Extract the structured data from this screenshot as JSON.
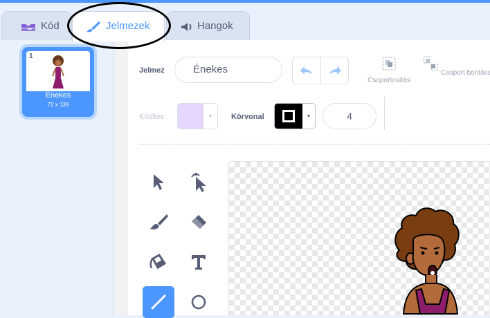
{
  "tabs": {
    "code_label": "Kód",
    "costumes_label": "Jelmezek",
    "sounds_label": "Hangok"
  },
  "costume_list": [
    {
      "number": "1",
      "name": "Énekes",
      "size": "72 x 139"
    }
  ],
  "toolbar": {
    "costume_label": "Jelmez",
    "costume_name": "Énekes",
    "group_label": "Csoportosítás",
    "ungroup_label": "Csoport bontása",
    "fill_label": "Kitöltés",
    "outline_label": "Körvonal",
    "outline_width": "4"
  },
  "colors": {
    "accent": "#4c97ff",
    "fill_swatch": "#e5d7ff",
    "outline_swatch": "#000000"
  }
}
